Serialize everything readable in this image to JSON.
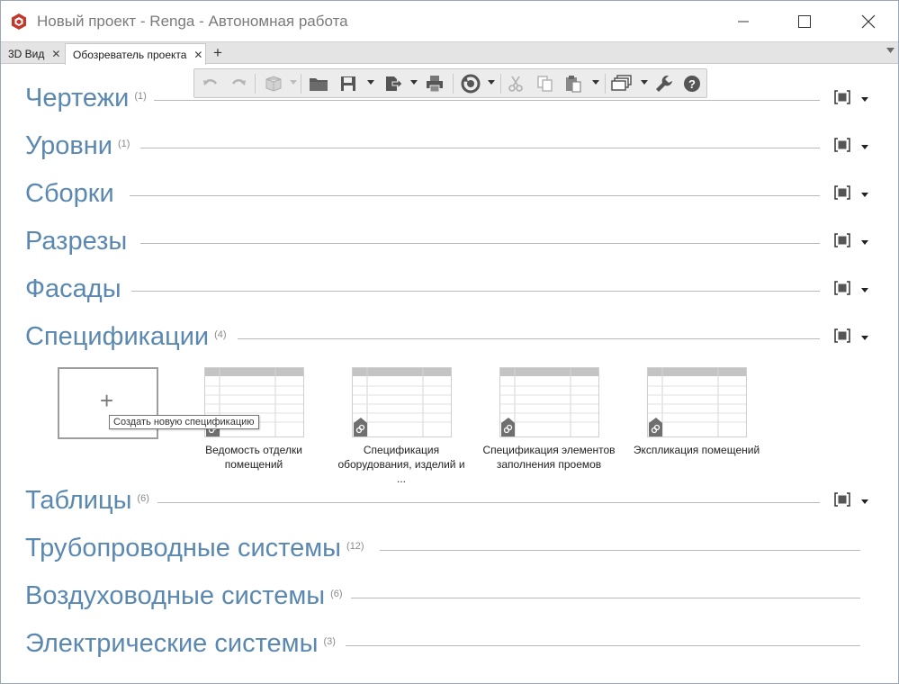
{
  "window": {
    "title": "Новый проект - Renga - Автономная работа",
    "accent": "#5b88b0"
  },
  "tabs": [
    {
      "label": "3D Вид",
      "active": false
    },
    {
      "label": "Обозреватель проекта",
      "active": true
    }
  ],
  "toolbar": {
    "icons": [
      "undo-icon",
      "redo-icon",
      "object-view-icon",
      "open-folder-icon",
      "save-icon",
      "export-icon",
      "print-icon",
      "sync-icon",
      "cut-icon",
      "copy-icon",
      "paste-icon",
      "views-icon",
      "settings-wrench-icon",
      "help-icon"
    ]
  },
  "sections": [
    {
      "title": "Чертежи",
      "count": "(1)",
      "has_controls": true
    },
    {
      "title": "Уровни",
      "count": "(1)",
      "has_controls": true
    },
    {
      "title": "Сборки",
      "count": "",
      "has_controls": true
    },
    {
      "title": "Разрезы",
      "count": "",
      "has_controls": true
    },
    {
      "title": "Фасады",
      "count": "",
      "has_controls": true
    },
    {
      "title": "Спецификации",
      "count": "(4)",
      "has_controls": true
    },
    {
      "title": "Таблицы",
      "count": "(6)",
      "has_controls": true
    },
    {
      "title": "Трубопроводные системы",
      "count": "(12)",
      "has_controls": false
    },
    {
      "title": "Воздуховодные системы",
      "count": "(6)",
      "has_controls": false
    },
    {
      "title": "Электрические системы",
      "count": "(3)",
      "has_controls": false
    }
  ],
  "specifications": {
    "create_tooltip": "Создать новую спецификацию",
    "items": [
      {
        "line1": "Ведомость отделки",
        "line2": "помещений"
      },
      {
        "line1": "Спецификация",
        "line2": "оборудования, изделий и ..."
      },
      {
        "line1": "Спецификация элементов",
        "line2": "заполнения проемов"
      },
      {
        "line1": "Экспликация помещений",
        "line2": ""
      }
    ]
  }
}
